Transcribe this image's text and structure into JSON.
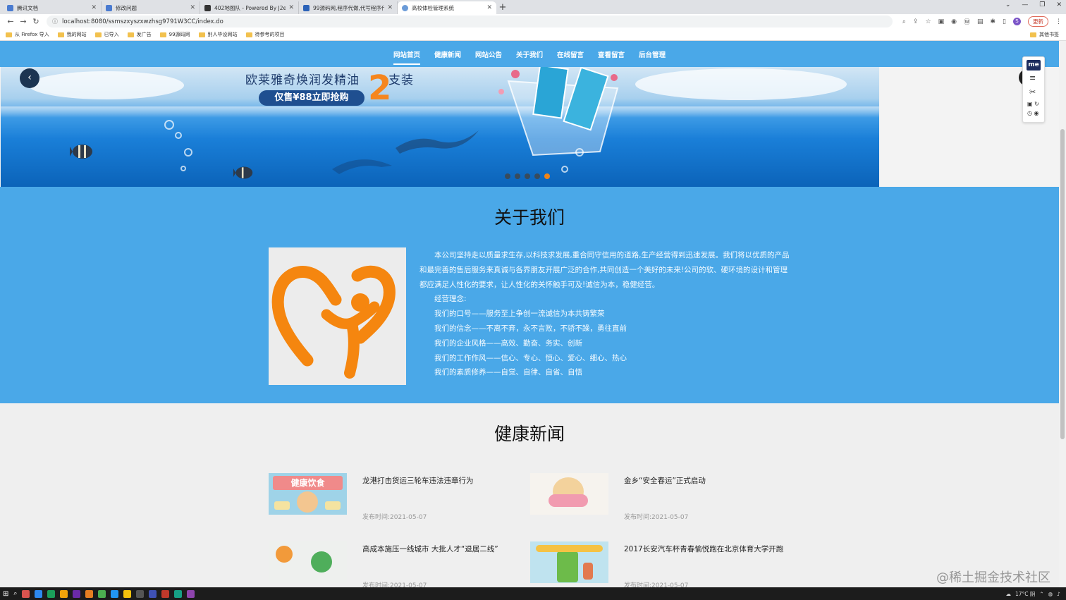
{
  "browser": {
    "tabs": [
      {
        "label": "腾讯文档",
        "active": false
      },
      {
        "label": "修改问题",
        "active": false
      },
      {
        "label": "402地图队 - Powered By J2eeF",
        "active": false
      },
      {
        "label": "99源码网,程序代做,代写程序代码",
        "active": false
      },
      {
        "label": "高校体检管理系统",
        "active": true
      }
    ],
    "url": "localhost:8080/ssmszxyszxwzhsg9791W3CC/index.do",
    "profile_initial": "S",
    "update_label": "更新",
    "bookmarks": [
      "从 Firefox 导入",
      "我的网站",
      "已导入",
      "发广告",
      "99源码网",
      "别人毕设网站",
      "待参考的项目"
    ],
    "other_bookmarks": "其他书签"
  },
  "site": {
    "nav": [
      "网站首页",
      "健康新闻",
      "网站公告",
      "关于我们",
      "在线留言",
      "查看留言",
      "后台管理"
    ],
    "banner": {
      "headline": "欧莱雅奇焕润发精油",
      "big_number": "2",
      "suffix": "支装",
      "pill": "仅售¥88立即抢购",
      "slide_count": 5,
      "active_slide": 4
    },
    "about": {
      "title": "关于我们",
      "paragraph": "本公司坚持走以质量求生存,以科技求发展,重合同守信用的道路,生产经营得到迅速发展。我们将以优质的产品和最完善的售后服务来真诚与各界朋友开展广泛的合作,共同创造一个美好的未来!公司的软、硬环境的设计和管理都应满足人性化的要求，让人性化的关怀触手可及!诚信为本，稳健经营。",
      "lines": [
        "经营理念:",
        "我们的口号——服务至上争创一流诚信为本共铸繁荣",
        "我们的信念——不离不弃，永不言败，不骄不躁，勇往直前",
        "我们的企业风格——高效、勤奋、务实、创新",
        "我们的工作作风——信心、专心、恒心、爱心、细心、热心",
        "我们的素质修养——自觉、自律、自省、自悟"
      ]
    },
    "news": {
      "title": "健康新闻",
      "items": [
        {
          "title": "龙港打击货运三轮车违法违章行为",
          "date": "发布时间:2021-05-07",
          "thumb_text": "健康饮食"
        },
        {
          "title": "金乡“安全春运”正式启动",
          "date": "发布时间:2021-05-07",
          "thumb_text": ""
        },
        {
          "title": "高成本施压一线城市 大批人才“退居二线”",
          "date": "发布时间:2021-05-07",
          "thumb_text": ""
        },
        {
          "title": "2017长安汽车杯青春愉悦跑在北京体育大学开跑",
          "date": "发布时间:2021-05-07",
          "thumb_text": ""
        }
      ]
    }
  },
  "extension_badge": "me",
  "watermark": "@稀土掘金技术社区",
  "taskbar": {
    "weather": "17°C 阴"
  },
  "colors": {
    "nav_blue": "#4aa8e8",
    "accent_orange": "#f5861f",
    "pill_blue": "#1f4f90"
  }
}
